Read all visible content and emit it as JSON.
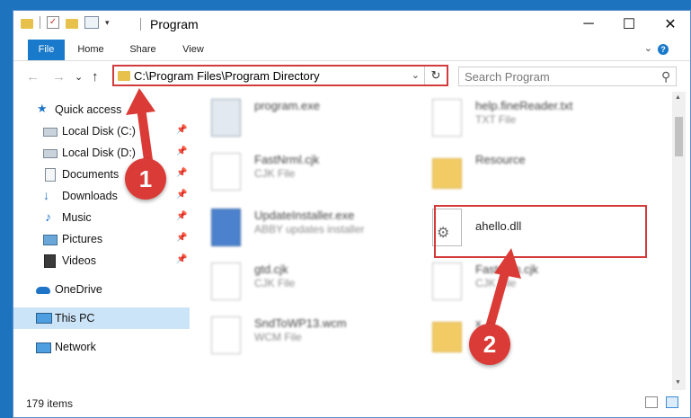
{
  "window": {
    "title": "Program",
    "controls": {
      "minimize": "─",
      "maximize": "☐",
      "close": "✕"
    }
  },
  "quick_access_toolbar": {
    "dropdown": "▾"
  },
  "ribbon": {
    "tabs": [
      "File",
      "Home",
      "Share",
      "View"
    ],
    "collapse_icon": "⌄",
    "help_icon": "?"
  },
  "address_bar": {
    "back": "←",
    "forward": "→",
    "recent": "⌄",
    "up": "↑",
    "path": "C:\\Program Files\\Program Directory",
    "dropdown": "⌄",
    "refresh": "↻"
  },
  "search": {
    "placeholder": "Search Program",
    "icon": "⚲"
  },
  "nav_pane": {
    "pin_glyph": "📌",
    "items": [
      {
        "label": "Quick access",
        "icon": "star-icon"
      },
      {
        "label": "Local Disk (C:)",
        "icon": "drive-icon",
        "pinned": true
      },
      {
        "label": "Local Disk (D:)",
        "icon": "drive-icon",
        "pinned": true
      },
      {
        "label": "Documents",
        "icon": "document-icon",
        "pinned": true
      },
      {
        "label": "Downloads",
        "icon": "download-icon",
        "pinned": true
      },
      {
        "label": "Music",
        "icon": "music-icon",
        "pinned": true
      },
      {
        "label": "Pictures",
        "icon": "picture-icon",
        "pinned": true
      },
      {
        "label": "Videos",
        "icon": "video-icon",
        "pinned": true
      },
      {
        "label": "OneDrive",
        "icon": "cloud-icon"
      },
      {
        "label": "This PC",
        "icon": "computer-icon",
        "selected": true
      },
      {
        "label": "Network",
        "icon": "network-icon"
      }
    ]
  },
  "files": [
    {
      "name": "program.exe",
      "type": "",
      "icon": "exe-icon"
    },
    {
      "name": "help.fineReader.txt",
      "type": "TXT File",
      "icon": "text-file-icon"
    },
    {
      "name": "FastNrml.cjk",
      "type": "CJK File",
      "icon": "file-icon"
    },
    {
      "name": "Resource",
      "type": "",
      "icon": "folder-icon"
    },
    {
      "name": "UpdateInstaller.exe",
      "type": "ABBY updates installer",
      "icon": "installer-icon"
    },
    {
      "name": "ahello.dll",
      "type": "",
      "icon": "dll-gear-icon"
    },
    {
      "name": "gtd.cjk",
      "type": "CJK File",
      "icon": "file-icon"
    },
    {
      "name": "Fastr...m.cjk",
      "type": "CJK File",
      "icon": "file-icon"
    },
    {
      "name": "SndToWP13.wcm",
      "type": "WCM File",
      "icon": "file-icon"
    },
    {
      "name": "x...",
      "type": "",
      "icon": "folder-icon"
    }
  ],
  "status_bar": {
    "item_count": "179 items"
  },
  "annotations": {
    "colors": {
      "accent": "#db3b36",
      "highlight_border": "#d33b3b",
      "ribbon_file_tab": "#1979ca",
      "selection": "#cce4f7"
    },
    "markers": [
      {
        "number": "1"
      },
      {
        "number": "2"
      }
    ]
  }
}
